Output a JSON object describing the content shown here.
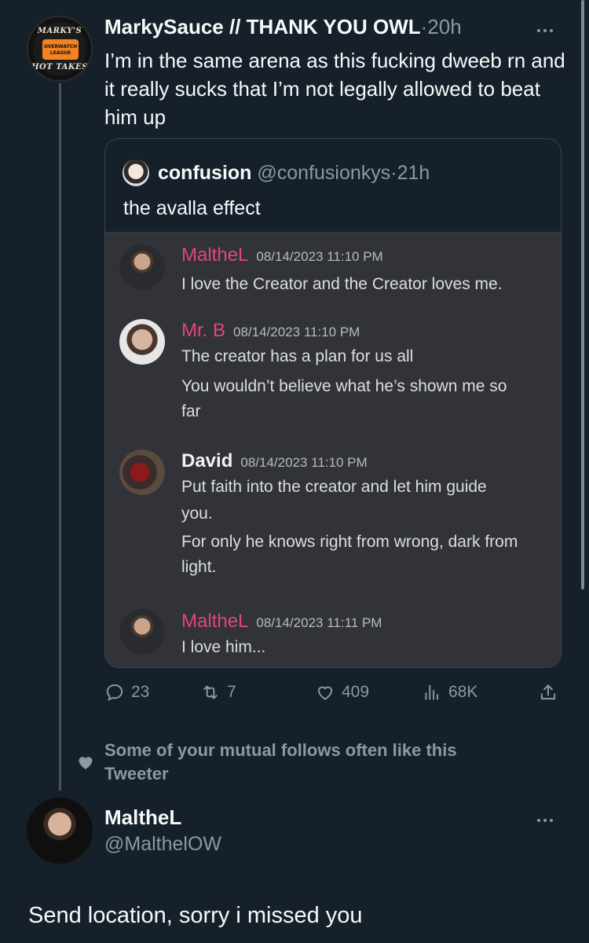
{
  "main_tweet": {
    "display_name": "MarkySauce // THANK YOU OWL",
    "time": "20h",
    "text": "I’m in the same arena as this fucking dweeb rn and it really sucks that I’m not legally allowed to beat him up",
    "avatar_text_top": "MARKY'S",
    "avatar_text_bottom": "HOT TAKES",
    "avatar_badge_1": "OVERWATCH",
    "avatar_badge_2": "LEAGUE"
  },
  "quote": {
    "display_name": "confusion",
    "handle": "@confusionkys",
    "time": "21h",
    "text": "the avalla effect",
    "messages": [
      {
        "user": "MaltheL",
        "time": "08/14/2023 11:10 PM",
        "lines": [
          "I love the Creator and the Creator loves me."
        ]
      },
      {
        "user": "Mr. B",
        "time": "08/14/2023 11:10 PM",
        "lines": [
          "The creator has a plan for us all",
          "You wouldn’t believe what he’s shown me so",
          "far"
        ]
      },
      {
        "user": "David",
        "time": "08/14/2023 11:10 PM",
        "lines": [
          "Put faith into the creator and let him guide",
          "you.",
          "For only he knows right from wrong, dark from",
          "light."
        ]
      },
      {
        "user": "MaltheL",
        "time": "08/14/2023 11:11 PM",
        "lines": [
          "I love him..."
        ]
      }
    ]
  },
  "actions": {
    "replies": "23",
    "retweets": "7",
    "likes": "409",
    "views": "68K"
  },
  "recommendation": {
    "text": "Some of your mutual follows often like this Tweeter"
  },
  "second_tweet": {
    "display_name": "MaltheL",
    "handle": "@MalthelOW",
    "text": "Send location, sorry i missed you"
  },
  "colors": {
    "background": "#15202b",
    "discord_bg": "#313338",
    "name_pink": "#e0457b",
    "muted": "#8b98a5"
  }
}
